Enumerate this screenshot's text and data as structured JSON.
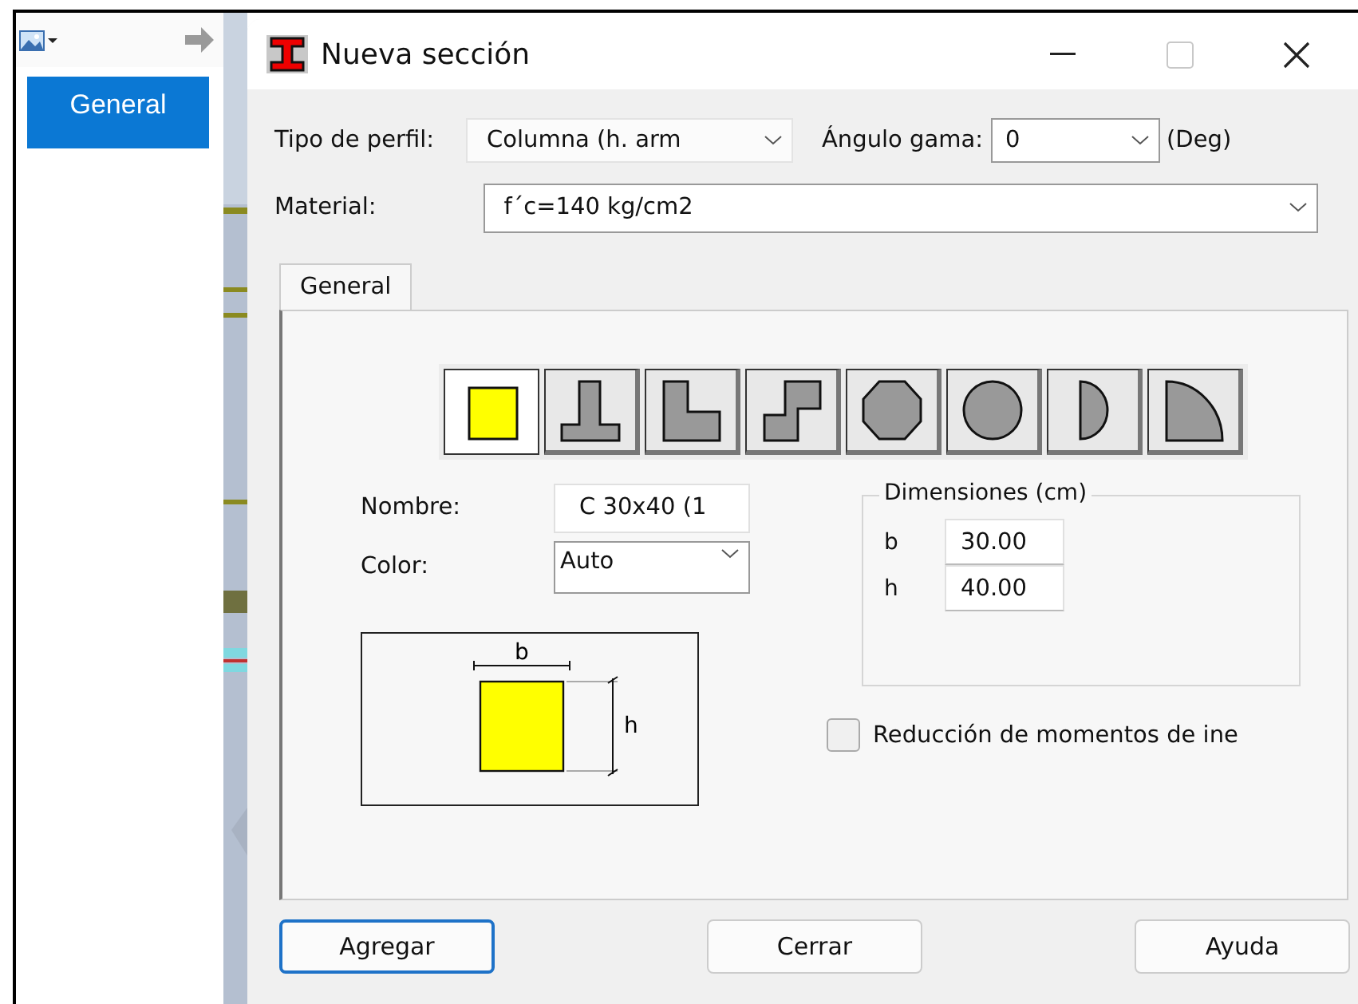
{
  "side_panel": {
    "button": "General"
  },
  "dialog": {
    "title": "Nueva sección",
    "profile": {
      "label": "Tipo de perfil:",
      "value": "Columna (h. arm"
    },
    "angle": {
      "label": "Ángulo gama:",
      "value": "0",
      "unit": "(Deg)"
    },
    "material": {
      "label": "Material:",
      "value": "f´c=140 kg/cm2"
    },
    "tabs": [
      {
        "label": "General",
        "selected": true
      }
    ],
    "shapes": [
      {
        "kind": "rect",
        "selected": true
      },
      {
        "kind": "tee",
        "selected": false
      },
      {
        "kind": "ell",
        "selected": false
      },
      {
        "kind": "zee",
        "selected": false
      },
      {
        "kind": "octagon",
        "selected": false
      },
      {
        "kind": "circle",
        "selected": false
      },
      {
        "kind": "half",
        "selected": false
      },
      {
        "kind": "quarter",
        "selected": false
      }
    ],
    "name": {
      "label": "Nombre:",
      "value": "C 30x40 (1"
    },
    "color": {
      "label": "Color:",
      "value": "Auto"
    },
    "diagram": {
      "width_label": "b",
      "height_label": "h"
    },
    "dimensions": {
      "title": "Dimensiones (cm)",
      "fields": [
        {
          "label": "b",
          "value": "30.00"
        },
        {
          "label": "h",
          "value": "40.00"
        }
      ]
    },
    "inertia_reduction": {
      "label": "Reducción de momentos de ine",
      "checked": false
    },
    "buttons": [
      {
        "label": "Agregar",
        "focused": true
      },
      {
        "label": "Cerrar",
        "focused": false
      },
      {
        "label": "Ayuda",
        "focused": false
      }
    ]
  }
}
